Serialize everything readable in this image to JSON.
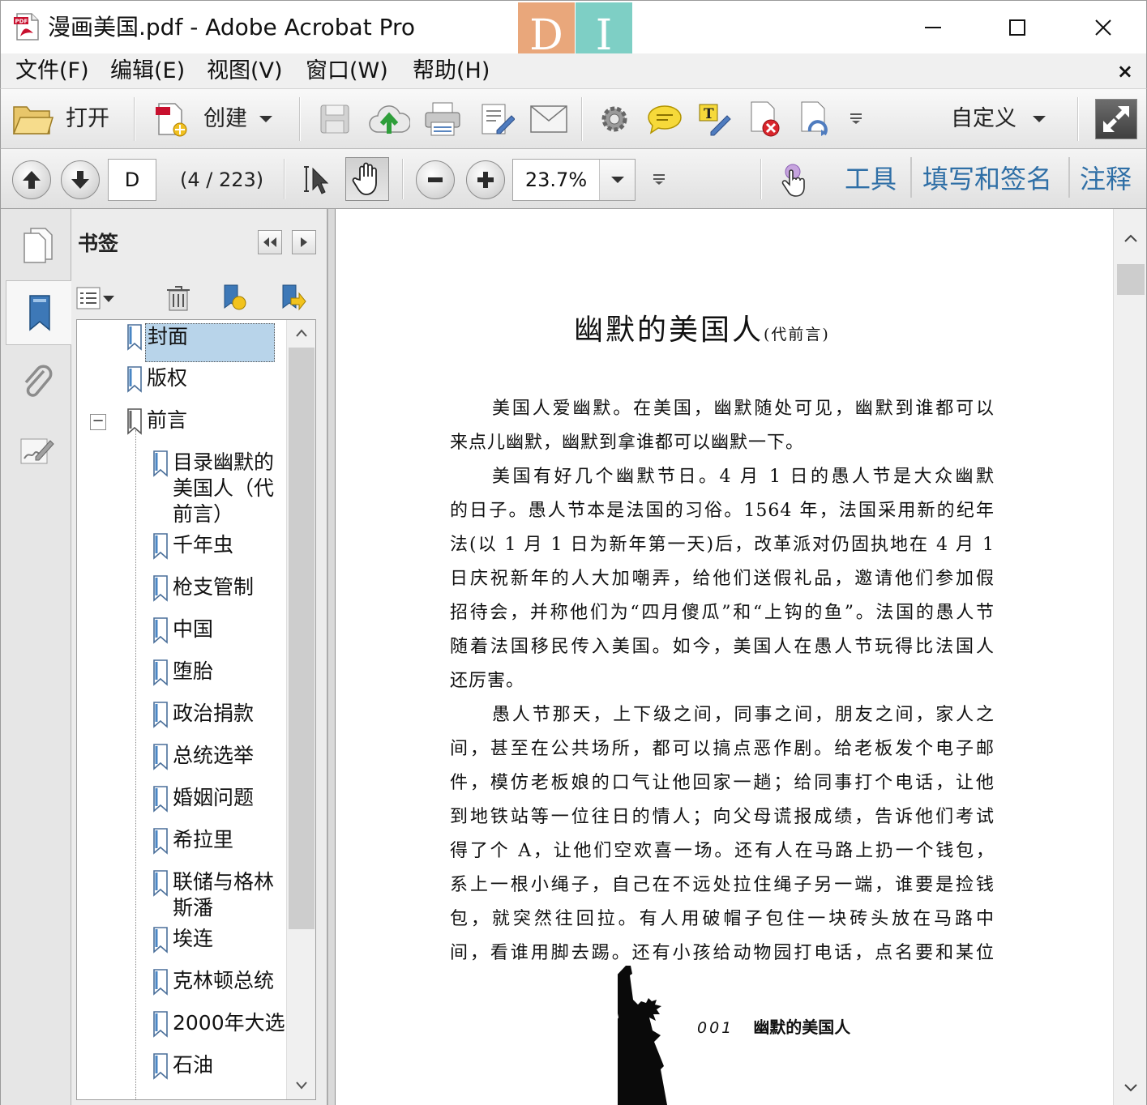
{
  "window": {
    "title": "漫画美国.pdf - Adobe Acrobat Pro",
    "logo_letters": [
      "D",
      "I"
    ]
  },
  "menu": {
    "items": [
      "文件(F)",
      "编辑(E)",
      "视图(V)",
      "窗口(W)",
      "帮助(H)"
    ],
    "close_glyph": "×"
  },
  "toolbar": {
    "open_label": "打开",
    "create_label": "创建",
    "customize_label": "自定义"
  },
  "navbar": {
    "page_input": "D",
    "page_count": "(4 / 223)",
    "zoom_value": "23.7%",
    "links": [
      "工具",
      "填写和签名",
      "注释"
    ]
  },
  "bookmarks": {
    "title": "书签",
    "items": [
      {
        "label": "封面",
        "level": 1,
        "selected": true
      },
      {
        "label": "版权",
        "level": 1
      },
      {
        "label": "前言",
        "level": 1,
        "expanded": true
      },
      {
        "label": "目录幽默的美国人（代前言）",
        "lines": [
          "目录幽默的",
          "美国人（代",
          "前言）"
        ],
        "level": 2
      },
      {
        "label": "千年虫",
        "level": 2
      },
      {
        "label": "枪支管制",
        "level": 2
      },
      {
        "label": "中国",
        "level": 2
      },
      {
        "label": "堕胎",
        "level": 2
      },
      {
        "label": "政治捐款",
        "level": 2
      },
      {
        "label": "总统选举",
        "level": 2
      },
      {
        "label": "婚姻问题",
        "level": 2
      },
      {
        "label": "希拉里",
        "level": 2
      },
      {
        "label": "联储与格林斯潘",
        "lines": [
          "联储与格林",
          "斯潘"
        ],
        "level": 2
      },
      {
        "label": "埃连",
        "level": 2
      },
      {
        "label": "克林顿总统",
        "level": 2
      },
      {
        "label": "2000年大选",
        "level": 2
      },
      {
        "label": "石油",
        "level": 2
      }
    ]
  },
  "document": {
    "title": "幽默的美国人",
    "title_suffix": "(代前言)",
    "lines": [
      {
        "text": "美国人爱幽默。在美国，幽默随处可见，幽默到谁都可以",
        "indent": true
      },
      {
        "text": "来点儿幽默，幽默到拿谁都可以幽默一下。",
        "last": true
      },
      {
        "text": "美国有好几个幽默节日。4 月 1 日的愚人节是大众幽默",
        "indent": true
      },
      {
        "text": "的日子。愚人节本是法国的习俗。1564 年，法国采用新的纪年"
      },
      {
        "text": "法(以 1 月 1 日为新年第一天)后，改革派对仍固执地在 4 月 1"
      },
      {
        "text": "日庆祝新年的人大加嘲弄，给他们送假礼品，邀请他们参加假"
      },
      {
        "text": "招待会，并称他们为“四月傻瓜”和“上钩的鱼”。法国的愚人节"
      },
      {
        "text": "随着法国移民传入美国。如今，美国人在愚人节玩得比法国人"
      },
      {
        "text": "还厉害。",
        "last": true
      },
      {
        "text": "愚人节那天，上下级之间，同事之间，朋友之间，家人之",
        "indent": true
      },
      {
        "text": "间，甚至在公共场所，都可以搞点恶作剧。给老板发个电子邮"
      },
      {
        "text": "件，模仿老板娘的口气让他回家一趟；给同事打个电话，让他"
      },
      {
        "text": "到地铁站等一位往日的情人；向父母谎报成绩，告诉他们考试"
      },
      {
        "text": "得了个 A，让他们空欢喜一场。还有人在马路上扔一个钱包，"
      },
      {
        "text": "系上一根小绳子，自己在不远处拉住绳子另一端，谁要是捡钱"
      },
      {
        "text": "包，就突然往回拉。有人用破帽子包住一块砖头放在马路中"
      },
      {
        "text": "间，看谁用脚去踢。还有小孩给动物园打电话，点名要和某位"
      }
    ],
    "footer_page": "001",
    "footer_title": "幽默的美国人"
  },
  "colors": {
    "link_blue": "#2f6fa6",
    "selection": "#b8d4ea",
    "logo_orange": "#e9a77b",
    "logo_teal": "#7ecfc5"
  }
}
